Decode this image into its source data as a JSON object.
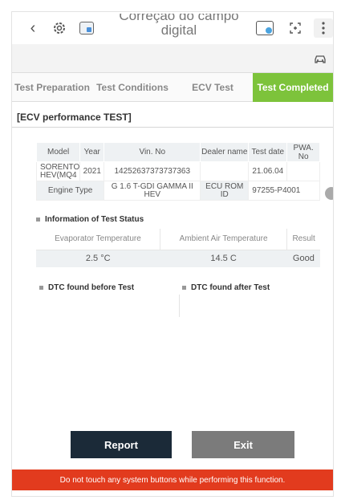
{
  "topbar": {
    "back_glyph": "‹",
    "title_line1": "Correção do campo",
    "title_line2": "digital",
    "icons": [
      "back-arrow-icon",
      "settings-gear-icon",
      "vci-card-icon",
      "vci-status-icon",
      "expand-icon",
      "more-options-icon"
    ]
  },
  "tabs": [
    {
      "label": "Test Preparation",
      "active": false
    },
    {
      "label": "Test Conditions",
      "active": false
    },
    {
      "label": "ECV Test",
      "active": false
    },
    {
      "label": "Test Completed",
      "active": true
    }
  ],
  "section_title": "[ECV performance TEST]",
  "vehicle_table": {
    "headers": [
      "Model",
      "Year",
      "Vin. No",
      "Dealer name",
      "Test date",
      "PWA. No"
    ],
    "row": {
      "model": "SORENTO HEV(MQ4",
      "year": "2021",
      "vin": "14252637373737363",
      "dealer": "",
      "test_date": "21.06.04",
      "pwa": ""
    },
    "engine_type_label": "Engine Type",
    "engine_type_value": "G 1.6 T-GDI GAMMA II HEV",
    "ecu_rom_label": "ECU ROM ID",
    "ecu_rom_value": "97255-P4001"
  },
  "status": {
    "title": "Information of Test Status",
    "headers": [
      "Evaporator Temperature",
      "Ambient Air Temperature",
      "Result"
    ],
    "values": [
      "2.5 °C",
      "14.5 C",
      "Good"
    ]
  },
  "dtc": {
    "before": "DTC found before Test",
    "after": "DTC found after Test"
  },
  "buttons": {
    "report": "Report",
    "exit": "Exit"
  },
  "warning": "Do not touch any system buttons while performing this function.",
  "colors": {
    "active_tab": "#7dc33b",
    "report_button": "#1b2a38",
    "exit_button": "#7b7b7b",
    "warning_bar": "#e23b1e"
  }
}
